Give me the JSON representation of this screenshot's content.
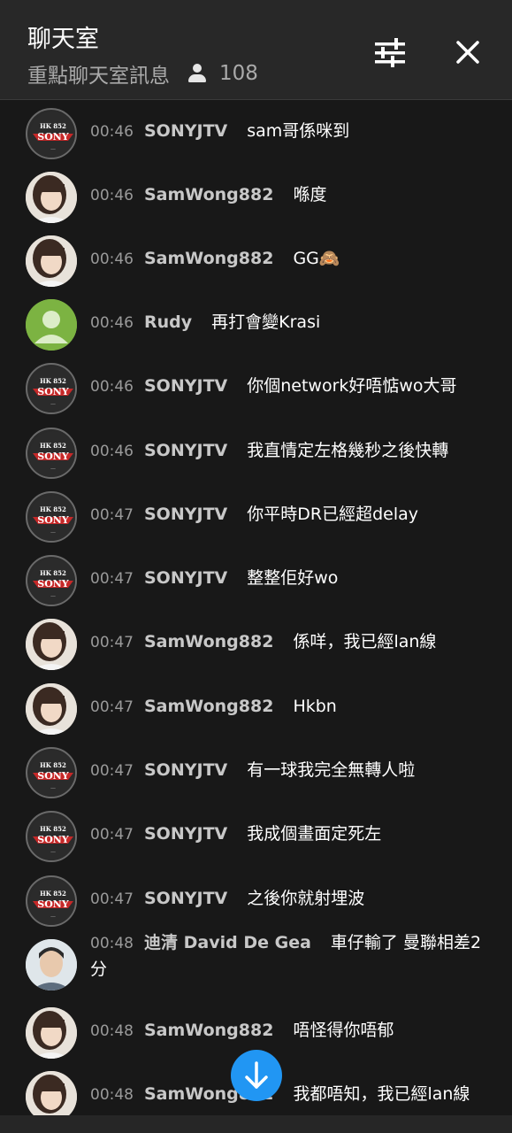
{
  "header": {
    "title": "聊天室",
    "subtitle": "重點聊天室訊息",
    "viewer_count": "108",
    "icons": {
      "filter": "tune-icon",
      "close": "close-icon",
      "viewers": "person-icon"
    }
  },
  "messages": [
    {
      "avatar": "sony",
      "time": "00:46",
      "author": "SONYJTV",
      "text": "sam哥係咪到"
    },
    {
      "avatar": "sam",
      "time": "00:46",
      "author": "SamWong882",
      "text": "喺度"
    },
    {
      "avatar": "sam",
      "time": "00:46",
      "author": "SamWong882",
      "text": "GG🙈"
    },
    {
      "avatar": "rudy",
      "time": "00:46",
      "author": "Rudy",
      "text": "再打會變Krasi"
    },
    {
      "avatar": "sony",
      "time": "00:46",
      "author": "SONYJTV",
      "text": "你個network好唔惦wo大哥"
    },
    {
      "avatar": "sony",
      "time": "00:46",
      "author": "SONYJTV",
      "text": "我直情定左格幾秒之後快轉"
    },
    {
      "avatar": "sony",
      "time": "00:47",
      "author": "SONYJTV",
      "text": "你平時DR已經超delay"
    },
    {
      "avatar": "sony",
      "time": "00:47",
      "author": "SONYJTV",
      "text": "整整佢好wo"
    },
    {
      "avatar": "sam",
      "time": "00:47",
      "author": "SamWong882",
      "text": "係咩，我已經lan線"
    },
    {
      "avatar": "sam",
      "time": "00:47",
      "author": "SamWong882",
      "text": "Hkbn"
    },
    {
      "avatar": "sony",
      "time": "00:47",
      "author": "SONYJTV",
      "text": "有一球我完全無轉人啦"
    },
    {
      "avatar": "sony",
      "time": "00:47",
      "author": "SONYJTV",
      "text": "我成個畫面定死左"
    },
    {
      "avatar": "sony",
      "time": "00:47",
      "author": "SONYJTV",
      "text": "之後你就射埋波"
    },
    {
      "avatar": "david",
      "time": "00:48",
      "author": "迪清 David De Gea",
      "text": "車仔輸了 曼聯相差2分"
    },
    {
      "avatar": "sam",
      "time": "00:48",
      "author": "SamWong882",
      "text": "唔怪得你唔郁"
    },
    {
      "avatar": "sam",
      "time": "00:48",
      "author": "SamWong882",
      "text": "我都唔知，我已經lan線"
    }
  ],
  "sony_logo": {
    "line1": "HK 852",
    "line2": "SONY"
  },
  "scroll_button": {
    "icon": "arrow-down-icon"
  },
  "colors": {
    "accent": "#2196f3",
    "background": "#181818",
    "header": "#282828"
  }
}
